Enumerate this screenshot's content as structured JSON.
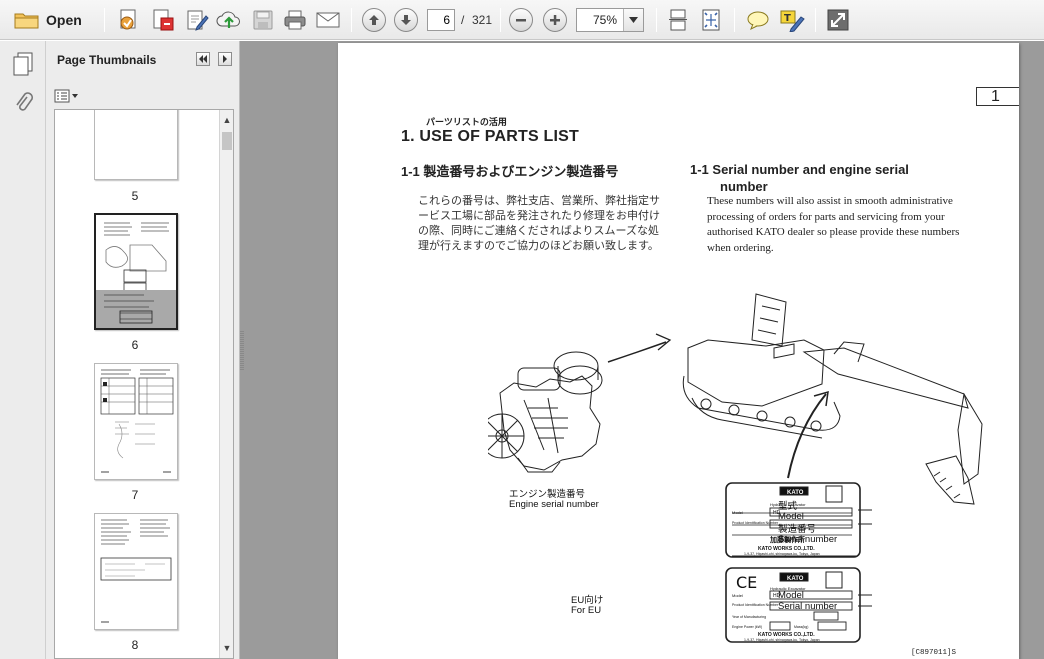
{
  "toolbar": {
    "open_label": "Open",
    "current_page": "6",
    "page_separator": "/",
    "total_pages": "321",
    "zoom": "75%"
  },
  "thumbnails": {
    "title": "Page Thumbnails",
    "items": [
      {
        "label": "5"
      },
      {
        "label": "6"
      },
      {
        "label": "7"
      },
      {
        "label": "8"
      }
    ]
  },
  "document": {
    "page_number": "1",
    "jp_subtitle": "パーツリストの活用",
    "section_title": "1.  USE OF PARTS LIST",
    "jp_heading": "1-1  製造番号およびエンジン製造番号",
    "en_heading": "1-1  Serial number and engine serial number",
    "jp_body": "これらの番号は、弊社支店、営業所、弊社指定サービス工場に部品を発注されたり修理をお申付けの際、同時にご連絡くださればよりスムーズな処理が行えますのでご協力のほどお願い致します。",
    "en_body": "These numbers will also assist in smooth administrative processing of orders for parts and servicing from your authorised KATO dealer so please provide these numbers when ordering.",
    "engine_label_jp": "エンジン製造番号",
    "engine_label_en": "Engine serial number",
    "model_label_jp": "型式",
    "model_label_en": "Model",
    "serial_label_jp": "製造番号",
    "serial_label_en": "Serial number",
    "eu_label_jp": "EU向け",
    "eu_label_en": "For EU",
    "eu_model_label": "Model",
    "eu_serial_label": "Serial number",
    "plate": {
      "brand": "KATO",
      "type": "Hydraulic Excavator",
      "model_field": "Model",
      "model_value": "HD",
      "product_id": "Product Identification Number",
      "maker_jp": "加藤製作所",
      "maker_en": "KATO WORKS CO.,LTD.",
      "address": "1-9-37, Higashi-ohi, shinagawa-ku, Tokyo, Japan",
      "ce": "CE",
      "year": "Year of Manufacturing",
      "engine_power": "Engine Power (kW)",
      "mass": "Mass(kg)"
    },
    "footer_code": "[C897011]S"
  }
}
